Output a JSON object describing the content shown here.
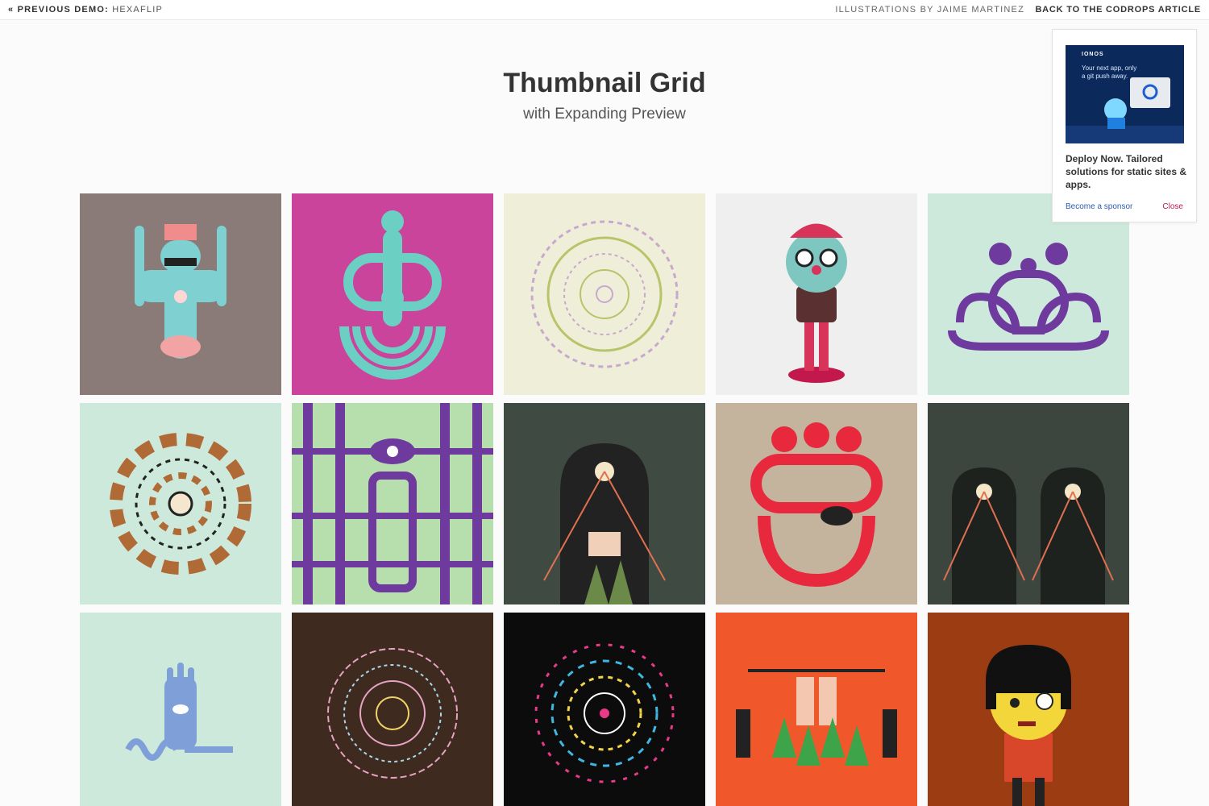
{
  "topbar": {
    "prev_prefix": "« PREVIOUS DEMO:",
    "prev_name": "HEXAFLIP",
    "credit": "ILLUSTRATIONS BY JAIME MARTINEZ",
    "back": "BACK TO THE CODROPS ARTICLE"
  },
  "header": {
    "title": "Thumbnail Grid",
    "subtitle": "with Expanding Preview"
  },
  "grid": {
    "tiles": [
      {
        "bg": "#8a7a78",
        "motif": "figure-cyan"
      },
      {
        "bg": "#c9449a",
        "motif": "figure-arch"
      },
      {
        "bg": "#efefd9",
        "motif": "mandala-light"
      },
      {
        "bg": "#efefef",
        "motif": "boy-cap"
      },
      {
        "bg": "#cce9dc",
        "motif": "purple-octopus"
      },
      {
        "bg": "#cce9dc",
        "motif": "mandala-eyes"
      },
      {
        "bg": "#b7dfae",
        "motif": "pattern-purple"
      },
      {
        "bg": "#3f4a42",
        "motif": "forest-scene"
      },
      {
        "bg": "#c4b39d",
        "motif": "red-creature"
      },
      {
        "bg": "#3c463f",
        "motif": "forest-pattern"
      },
      {
        "bg": "#cce9dc",
        "motif": "blue-hand"
      },
      {
        "bg": "#3e2a1e",
        "motif": "mandala-dark"
      },
      {
        "bg": "#0c0c0c",
        "motif": "mandala-black"
      },
      {
        "bg": "#f0582c",
        "motif": "orange-scene"
      },
      {
        "bg": "#9c3c12",
        "motif": "girl-yellow"
      }
    ]
  },
  "ad": {
    "brand": "IONOS",
    "tagline": "Your next app, only a git push away.",
    "text": "Deploy Now. Tailored solutions for static sites & apps.",
    "sponsor": "Become a sponsor",
    "close": "Close"
  }
}
